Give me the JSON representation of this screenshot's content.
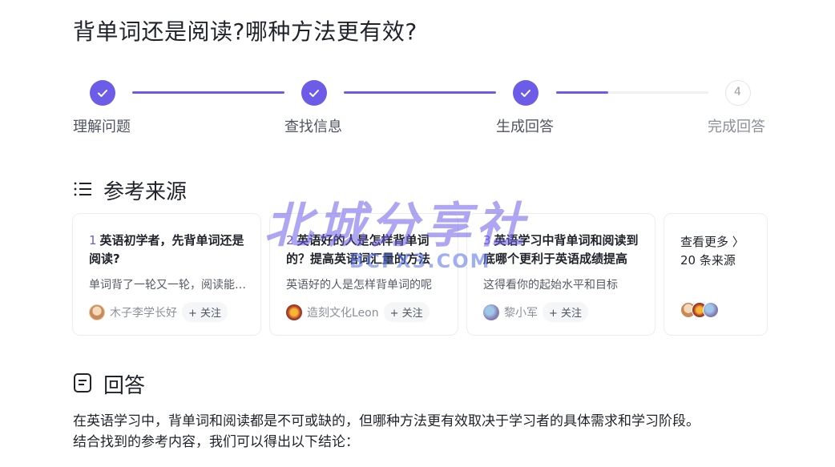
{
  "page": {
    "title": "背单词还是阅读?哪种方法更有效?"
  },
  "stepper": {
    "steps": [
      {
        "label": "理解问题",
        "status": "done"
      },
      {
        "label": "查找信息",
        "status": "done"
      },
      {
        "label": "生成回答",
        "status": "done"
      },
      {
        "label": "完成回答",
        "status": "pending",
        "number": "4"
      }
    ],
    "accent_color": "#6c5ce7"
  },
  "sources": {
    "heading": "参考来源",
    "cards": [
      {
        "num": "1",
        "title": "英语初学者，先背单词还是阅读?",
        "snippet": "单词背了一轮又一轮，阅读能力却没有提高",
        "author": "木子李学长好",
        "follow": "+ 关注"
      },
      {
        "num": "2",
        "title": "英语好的人是怎样背单词的？提高英语词汇量的方法",
        "snippet": "英语好的人是怎样背单词的呢",
        "author": "造刻文化Leon",
        "follow": "+ 关注"
      },
      {
        "num": "3",
        "title": "英语学习中背单词和阅读到底哪个更利于英语成绩提高",
        "snippet": "这得看你的起始水平和目标",
        "author": "黎小军",
        "follow": "+ 关注"
      }
    ],
    "more": {
      "label": "查看更多 〉",
      "count": "20 条来源"
    }
  },
  "answer": {
    "heading": "回答",
    "text_line1": "在英语学习中，背单词和阅读都是不可或缺的，但哪种方法更有效取决于学习者的具体需求和学习阶段。",
    "text_line2": "结合找到的参考内容，我们可以得出以下结论："
  },
  "watermark": {
    "cn": "北城分享社",
    "en": "BCFX3.COM"
  }
}
